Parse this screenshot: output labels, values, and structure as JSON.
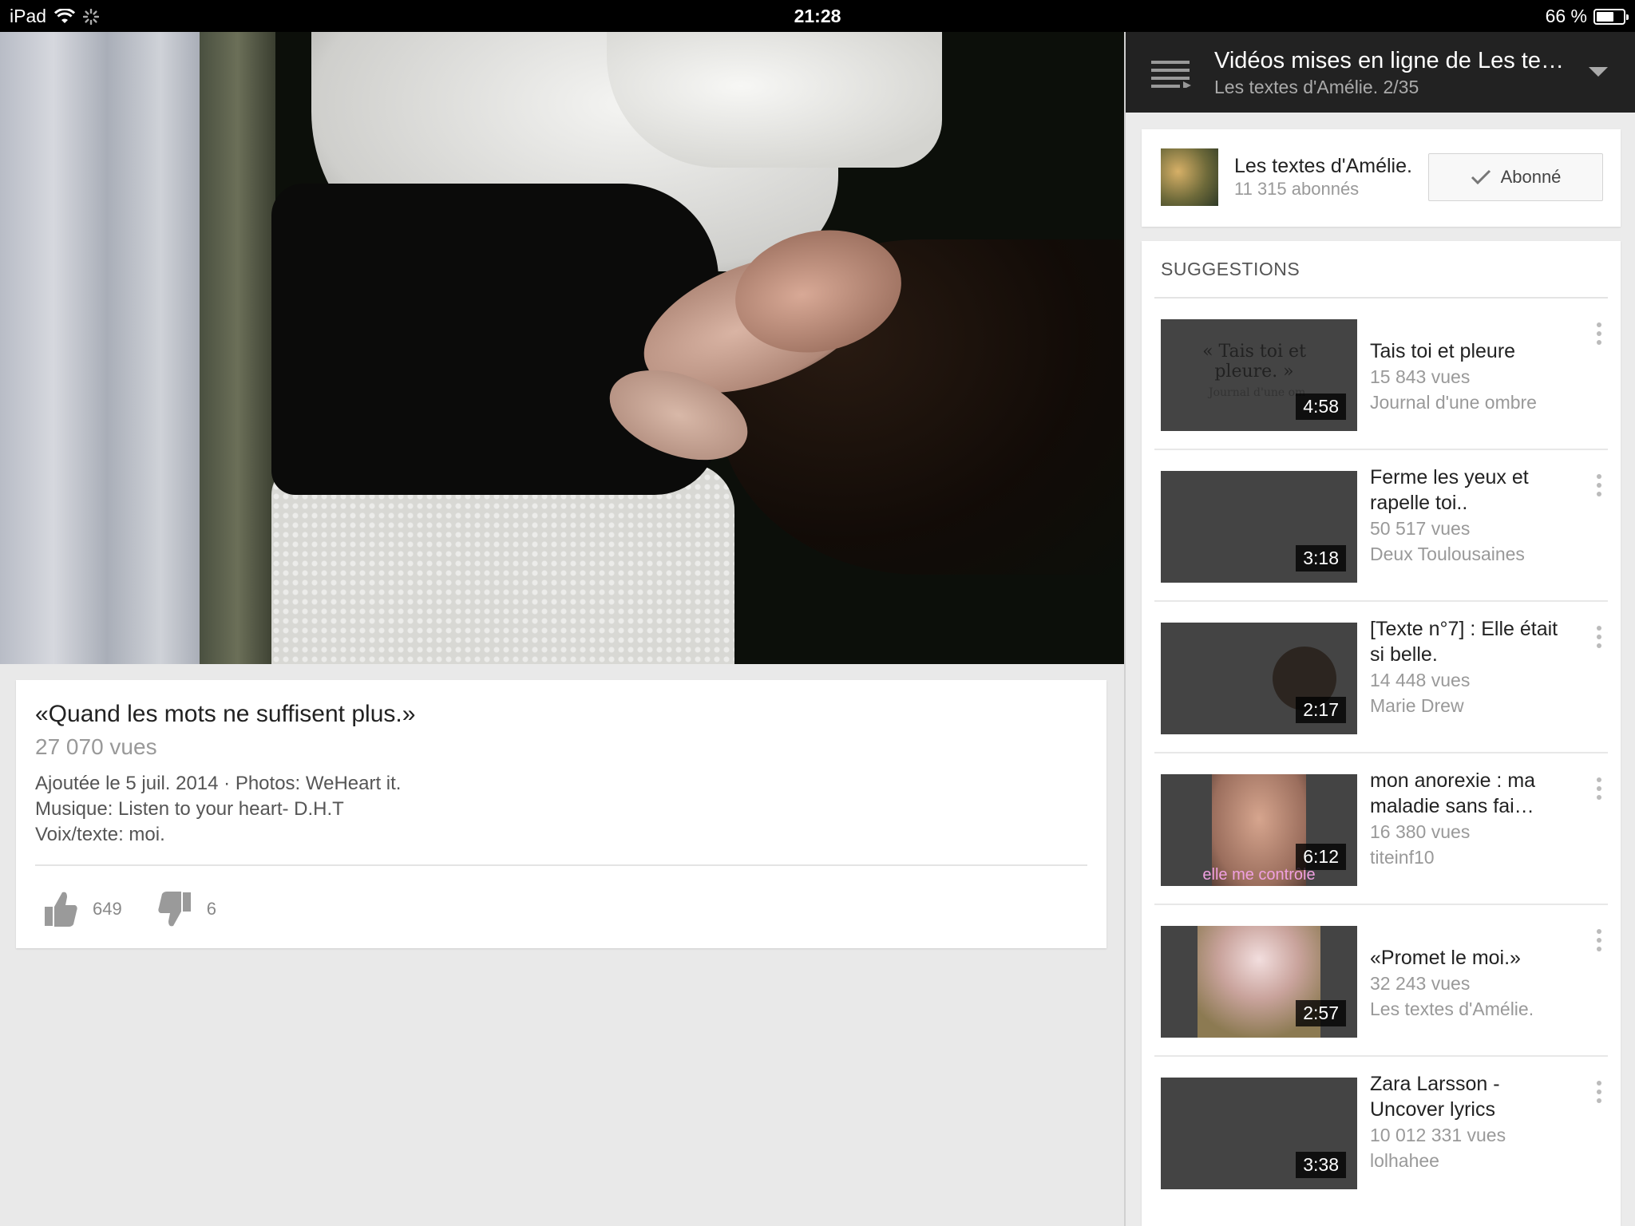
{
  "status_bar": {
    "device": "iPad",
    "time": "21:28",
    "battery": "66 %",
    "battery_level": 0.66
  },
  "video": {
    "title": "«Quand les mots ne suffisent plus.»",
    "views": "27 070 vues",
    "description": [
      "Ajoutée le 5 juil. 2014 · Photos: WeHeart it.",
      "Musique: Listen to your heart- D.H.T",
      "Voix/texte: moi."
    ],
    "likes": "649",
    "dislikes": "6"
  },
  "playlist": {
    "title": "Vidéos mises en ligne de Les textes d'Amélie.",
    "subtitle": "Les textes d'Amélie.  2/35"
  },
  "channel": {
    "name": "Les textes d'Amélie.",
    "subscribers": "11 315 abonnés",
    "subscribe_label": "Abonné"
  },
  "suggestions": {
    "header": "SUGGESTIONS",
    "items": [
      {
        "title": "Tais toi et pleure",
        "views": "15 843 vues",
        "channel": "Journal d'une ombre",
        "duration": "4:58",
        "thumb_text": "« Tais toi et pleure. »",
        "thumb_sub": "Journal d'une om"
      },
      {
        "title": "Ferme les yeux et rapelle toi..",
        "views": "50 517 vues",
        "channel": "Deux Toulousaines",
        "duration": "3:18"
      },
      {
        "title": "[Texte n°7] : Elle était si belle.",
        "views": "14 448 vues",
        "channel": "Marie Drew",
        "duration": "2:17"
      },
      {
        "title": "mon anorexie : ma maladie sans fai…",
        "views": "16 380 vues",
        "channel": "titeinf10",
        "duration": "6:12",
        "thumb_caption": "elle me contrôle"
      },
      {
        "title": "«Promet le moi.»",
        "views": "32 243 vues",
        "channel": "Les textes d'Amélie.",
        "duration": "2:57"
      },
      {
        "title": "Zara Larsson - Uncover lyrics",
        "views": "10 012 331 vues",
        "channel": "lolhahee",
        "duration": "3:38"
      }
    ]
  }
}
